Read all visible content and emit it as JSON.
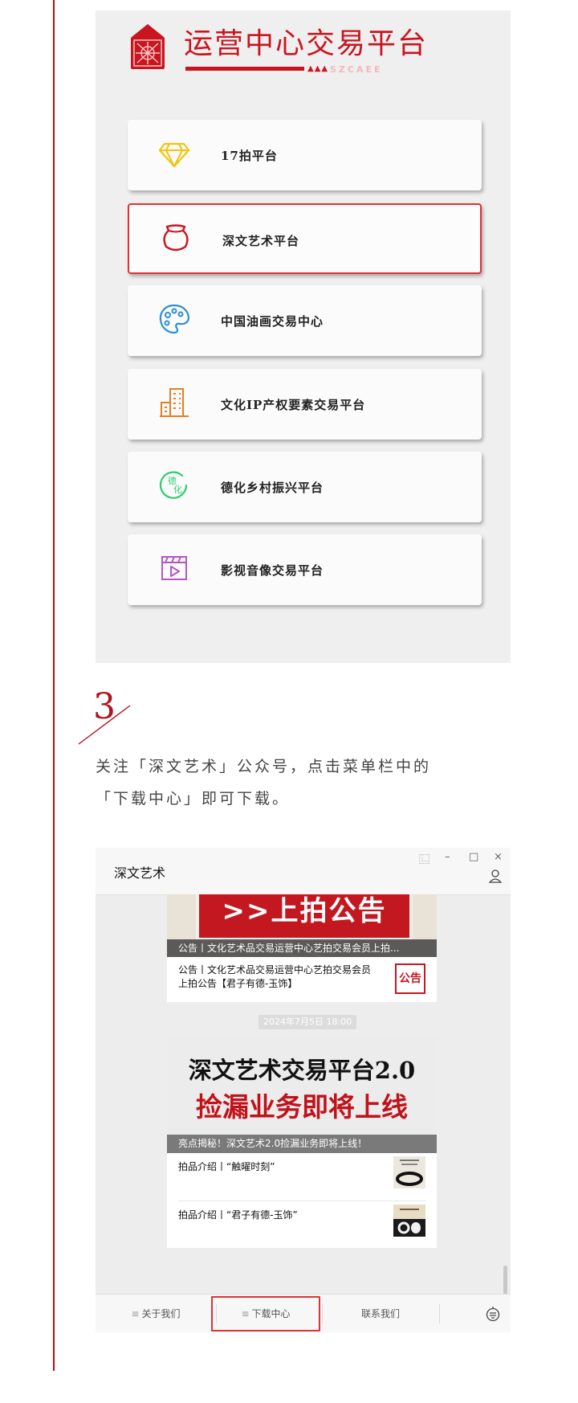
{
  "colors": {
    "brand_red": "#c9151e",
    "accent_line": "#b3121c",
    "highlight_border": "#e23134"
  },
  "screenshot1": {
    "logo": {
      "title": "运营中心交易平台",
      "sub": "SZCAEE",
      "dots": "▲▲▲"
    },
    "platforms": [
      {
        "label": "17拍平台",
        "icon": "diamond-icon",
        "icon_color": "#f1c40f",
        "selected": false
      },
      {
        "label": "深文艺术平台",
        "icon": "jar-icon",
        "icon_color": "#c9151e",
        "selected": true
      },
      {
        "label": "中国油画交易中心",
        "icon": "palette-icon",
        "icon_color": "#2d8fd5",
        "selected": false
      },
      {
        "label": "文化IP产权要素交易平台",
        "icon": "building-icon",
        "icon_color": "#e67e22",
        "selected": false
      },
      {
        "label": "德化乡村振兴平台",
        "icon": "dehua-icon",
        "icon_color": "#2ecc71",
        "selected": false
      },
      {
        "label": "影视音像交易平台",
        "icon": "video-icon",
        "icon_color": "#b455c9",
        "selected": false
      }
    ]
  },
  "step": {
    "number": "3",
    "line1": "关注「深文艺术」公众号，点击菜单栏中的",
    "line2": "「下载中心」即可下载。"
  },
  "screenshot2": {
    "title": "深文艺术",
    "controls": [
      "⿺",
      "–",
      "□",
      "×"
    ],
    "banner_board": ">>上拍公告<<",
    "banner_caption": "公告丨文化艺术品交易运营中心艺拍交易会员上拍...",
    "news_text": "公告丨文化艺术品交易运营中心艺拍交易会员上拍公告【君子有德-玉饰】",
    "notice_badge": "公告",
    "date": "2024年7月5日 18:00",
    "hero_line1": "深文艺术交易平台2.0",
    "hero_line2": "捡漏业务即将上线",
    "hero_caption": "亮点揭秘！深文艺术2.0捡漏业务即将上线！",
    "articles": [
      {
        "title": "拍品介绍丨“触曜时刻”"
      },
      {
        "title": "拍品介绍丨“君子有德-玉饰”"
      }
    ],
    "menu": [
      {
        "label": "关于我们",
        "highlight": false
      },
      {
        "label": "下载中心",
        "highlight": true
      },
      {
        "label": "联系我们",
        "highlight": false
      }
    ]
  }
}
